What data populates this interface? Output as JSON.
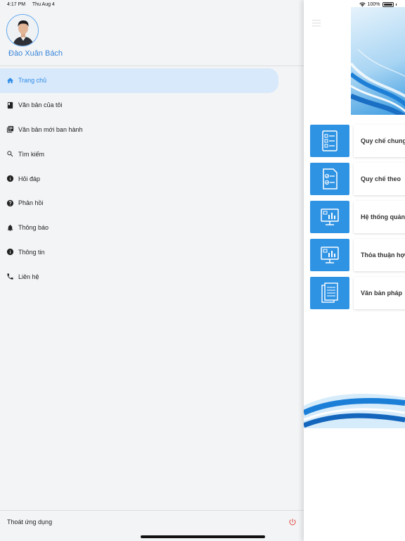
{
  "status": {
    "time": "4:17 PM",
    "date": "Thu Aug 4",
    "battery": "100%"
  },
  "user": {
    "name": "Đào Xuân Bách"
  },
  "menu": [
    {
      "label": "Trang chủ",
      "icon": "home-icon",
      "active": true
    },
    {
      "label": "Văn bản của tôi",
      "icon": "book-icon"
    },
    {
      "label": "Văn bản mới ban hành",
      "icon": "library-books-icon"
    },
    {
      "label": "Tìm kiếm",
      "icon": "search-icon"
    },
    {
      "label": "Hỏi đáp",
      "icon": "info-icon"
    },
    {
      "label": "Phản hồi",
      "icon": "help-icon"
    },
    {
      "label": "Thông báo",
      "icon": "bell-icon"
    },
    {
      "label": "Thông tin",
      "icon": "info-icon"
    },
    {
      "label": "Liên hệ",
      "icon": "phone-icon"
    }
  ],
  "logout": {
    "label": "Thoát ứng dụng"
  },
  "cards": [
    {
      "label": "Quy chế chung",
      "icon": "checklist-icon"
    },
    {
      "label": "Quy chế theo",
      "icon": "checklist-doc-icon"
    },
    {
      "label": "Hệ thống quản",
      "icon": "monitor-chart-icon"
    },
    {
      "label": "Thỏa thuận hợ",
      "icon": "monitor-chart-icon"
    },
    {
      "label": "Văn bản pháp",
      "icon": "document-icon"
    }
  ],
  "colors": {
    "accent": "#2f93e4",
    "active_bg": "#d7e9fb",
    "name": "#3a86d9",
    "power": "#e0443a"
  }
}
